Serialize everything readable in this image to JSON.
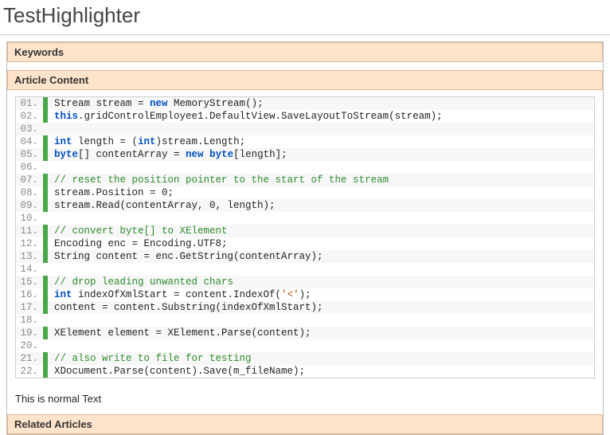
{
  "title": "TestHighlighter",
  "sections": {
    "keywords": "Keywords",
    "article_content": "Article Content",
    "related_articles": "Related Articles"
  },
  "normal_text": "This is normal Text",
  "code": {
    "lines": [
      {
        "num": "01.",
        "mark": true,
        "tokens": [
          {
            "t": "Stream stream = "
          },
          {
            "t": "new",
            "c": "kw"
          },
          {
            "t": " MemoryStream();"
          }
        ]
      },
      {
        "num": "02.",
        "mark": true,
        "tokens": [
          {
            "t": "this",
            "c": "kw"
          },
          {
            "t": ".gridControlEmployee1.DefaultView.SaveLayoutToStream(stream);"
          }
        ]
      },
      {
        "num": "03.",
        "mark": false,
        "tokens": []
      },
      {
        "num": "04.",
        "mark": true,
        "tokens": [
          {
            "t": "int",
            "c": "kw"
          },
          {
            "t": " length = ("
          },
          {
            "t": "int",
            "c": "kw"
          },
          {
            "t": ")stream.Length;"
          }
        ]
      },
      {
        "num": "05.",
        "mark": true,
        "tokens": [
          {
            "t": "byte",
            "c": "kw"
          },
          {
            "t": "[] contentArray = "
          },
          {
            "t": "new",
            "c": "kw"
          },
          {
            "t": " "
          },
          {
            "t": "byte",
            "c": "kw"
          },
          {
            "t": "[length];"
          }
        ]
      },
      {
        "num": "06.",
        "mark": false,
        "tokens": []
      },
      {
        "num": "07.",
        "mark": true,
        "tokens": [
          {
            "t": "// reset the position pointer to the start of the stream",
            "c": "cm"
          }
        ]
      },
      {
        "num": "08.",
        "mark": true,
        "tokens": [
          {
            "t": "stream.Position = 0;"
          }
        ]
      },
      {
        "num": "09.",
        "mark": true,
        "tokens": [
          {
            "t": "stream.Read(contentArray, 0, length);"
          }
        ]
      },
      {
        "num": "10.",
        "mark": false,
        "tokens": []
      },
      {
        "num": "11.",
        "mark": true,
        "tokens": [
          {
            "t": "// convert byte[] to XElement",
            "c": "cm"
          }
        ]
      },
      {
        "num": "12.",
        "mark": true,
        "tokens": [
          {
            "t": "Encoding enc = Encoding.UTF8;"
          }
        ]
      },
      {
        "num": "13.",
        "mark": true,
        "tokens": [
          {
            "t": "String content = enc.GetString(contentArray);"
          }
        ]
      },
      {
        "num": "14.",
        "mark": false,
        "tokens": []
      },
      {
        "num": "15.",
        "mark": true,
        "tokens": [
          {
            "t": "// drop leading unwanted chars",
            "c": "cm"
          }
        ]
      },
      {
        "num": "16.",
        "mark": true,
        "tokens": [
          {
            "t": "int",
            "c": "kw"
          },
          {
            "t": " indexOfXmlStart = content.IndexOf("
          },
          {
            "t": "'<'",
            "c": "str"
          },
          {
            "t": ");"
          }
        ]
      },
      {
        "num": "17.",
        "mark": true,
        "tokens": [
          {
            "t": "content = content.Substring(indexOfXmlStart);"
          }
        ]
      },
      {
        "num": "18.",
        "mark": false,
        "tokens": []
      },
      {
        "num": "19.",
        "mark": true,
        "tokens": [
          {
            "t": "XElement element = XElement.Parse(content);"
          }
        ]
      },
      {
        "num": "20.",
        "mark": false,
        "tokens": []
      },
      {
        "num": "21.",
        "mark": true,
        "tokens": [
          {
            "t": "// also write to file for testing",
            "c": "cm"
          }
        ]
      },
      {
        "num": "22.",
        "mark": true,
        "tokens": [
          {
            "t": "XDocument.Parse(content).Save(m_fileName);"
          }
        ]
      }
    ]
  }
}
